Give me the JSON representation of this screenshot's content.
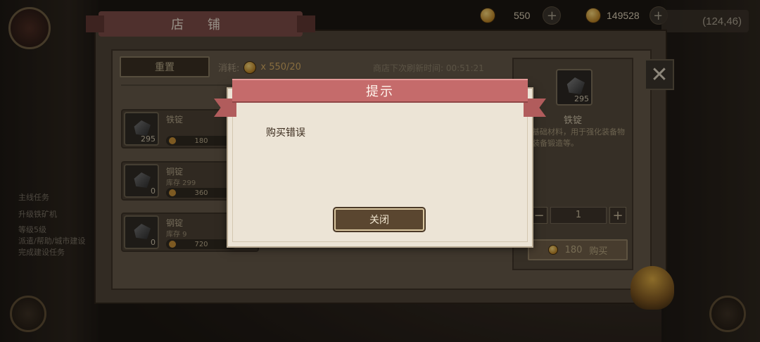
{
  "hud": {
    "currency_1_value": "550",
    "currency_2_value": "149528",
    "plus_label": "+",
    "coords": "(124,46)"
  },
  "shop": {
    "title": "店 铺",
    "reset_label": "重置",
    "cost_label": "消耗:",
    "cost_value": "x 550/20",
    "refresh_text": "商店下次刷新时间: 00:51:21",
    "items": [
      {
        "name": "铁锭",
        "stock": "",
        "count": "295",
        "price": "180"
      },
      {
        "name": "铜锭",
        "stock": "库存 299",
        "count": "0",
        "price": "360"
      },
      {
        "name": "钢锭",
        "stock": "库存 9",
        "count": "0",
        "price": "720"
      }
    ],
    "detail": {
      "count": "295",
      "name": "铁锭",
      "description": "基础材料，用于强化装备物装备锻造等。",
      "quantity": "1",
      "minus_label": "−",
      "plus_label": "+",
      "buy_price": "180",
      "buy_label": "购买"
    },
    "close_label": "✕"
  },
  "side": {
    "quest_title": "主线任务",
    "quest_line_1": "升级铁矿机",
    "quest_line_2": "等级5级",
    "quest_line_3": "派遣/帮助/城市建设",
    "quest_line_4": "完成建设任务"
  },
  "dialog": {
    "title": "提示",
    "message": "购买错误",
    "close_label": "关闭"
  }
}
